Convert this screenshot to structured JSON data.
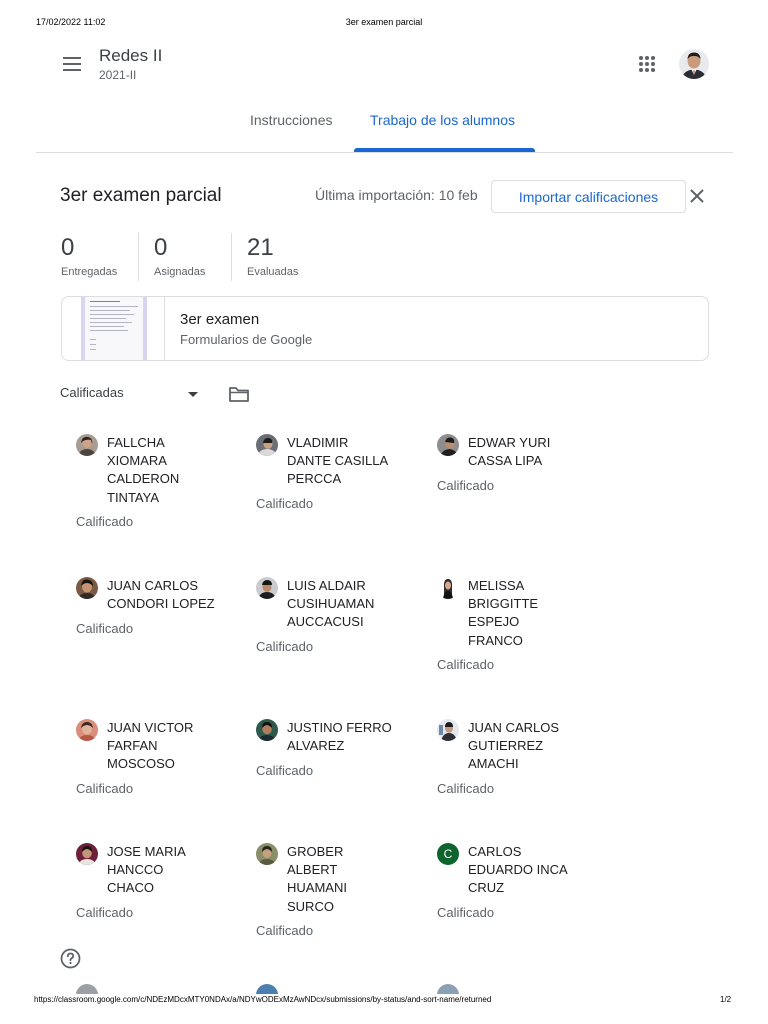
{
  "print": {
    "datetime": "17/02/2022 11:02",
    "title": "3er examen parcial",
    "url": "https://classroom.google.com/c/NDEzMDcxMTY0NDAx/a/NDYwODExMzAwNDcx/submissions/by-status/and-sort-name/returned",
    "page": "1/2"
  },
  "header": {
    "course_title": "Redes II",
    "course_subtitle": "2021-II",
    "menu_icon": "hamburger-menu-icon",
    "apps_icon": "google-apps-grid-icon"
  },
  "tabs": [
    {
      "label": "Instrucciones",
      "active": false
    },
    {
      "label": "Trabajo de los alumnos",
      "active": true
    }
  ],
  "assignment": {
    "title": "3er examen parcial",
    "last_import": "Última importación: 10 feb",
    "import_button": "Importar calificaciones",
    "close_icon": "close-x-icon"
  },
  "stats": [
    {
      "value": "0",
      "label": "Entregadas"
    },
    {
      "value": "0",
      "label": "Asignadas"
    },
    {
      "value": "21",
      "label": "Evaluadas"
    }
  ],
  "attachment": {
    "title": "3er examen",
    "subtitle": "Formularios de Google"
  },
  "filter": {
    "selected": "Calificadas",
    "folder_icon": "folder-icon"
  },
  "students": [
    {
      "lines": [
        "FALLCHA",
        "XIOMARA",
        "CALDERON",
        "TINTAYA"
      ],
      "status": "Calificado"
    },
    {
      "lines": [
        "VLADIMIR",
        "DANTE CASILLA",
        "PERCCA"
      ],
      "status": "Calificado"
    },
    {
      "lines": [
        "EDWAR YURI",
        "CASSA LIPA"
      ],
      "status": "Calificado"
    },
    {
      "lines": [
        "JUAN CARLOS",
        "CONDORI LOPEZ"
      ],
      "status": "Calificado"
    },
    {
      "lines": [
        "LUIS ALDAIR",
        "CUSIHUAMAN",
        "AUCCACUSI"
      ],
      "status": "Calificado"
    },
    {
      "lines": [
        "MELISSA",
        "BRIGGITTE",
        "ESPEJO",
        "FRANCO"
      ],
      "status": "Calificado"
    },
    {
      "lines": [
        "JUAN VICTOR",
        "FARFAN",
        "MOSCOSO"
      ],
      "status": "Calificado"
    },
    {
      "lines": [
        "JUSTINO FERRO",
        "ALVAREZ"
      ],
      "status": "Calificado"
    },
    {
      "lines": [
        "JUAN CARLOS",
        "GUTIERREZ",
        "AMACHI"
      ],
      "status": "Calificado"
    },
    {
      "lines": [
        "JOSE MARIA",
        "HANCCO",
        "CHACO"
      ],
      "status": "Calificado"
    },
    {
      "lines": [
        "GROBER",
        "ALBERT",
        "HUAMANI",
        "SURCO"
      ],
      "status": "Calificado"
    },
    {
      "lines": [
        "CARLOS",
        "EDUARDO INCA",
        "CRUZ"
      ],
      "status": "Calificado",
      "initial": "C"
    }
  ],
  "help_icon": "help-circle-icon",
  "colors": {
    "accent": "#1967d2",
    "text_primary": "#202124",
    "text_secondary": "#5f6368",
    "divider": "#dadce0",
    "initial_avatar": "#0d652d"
  }
}
